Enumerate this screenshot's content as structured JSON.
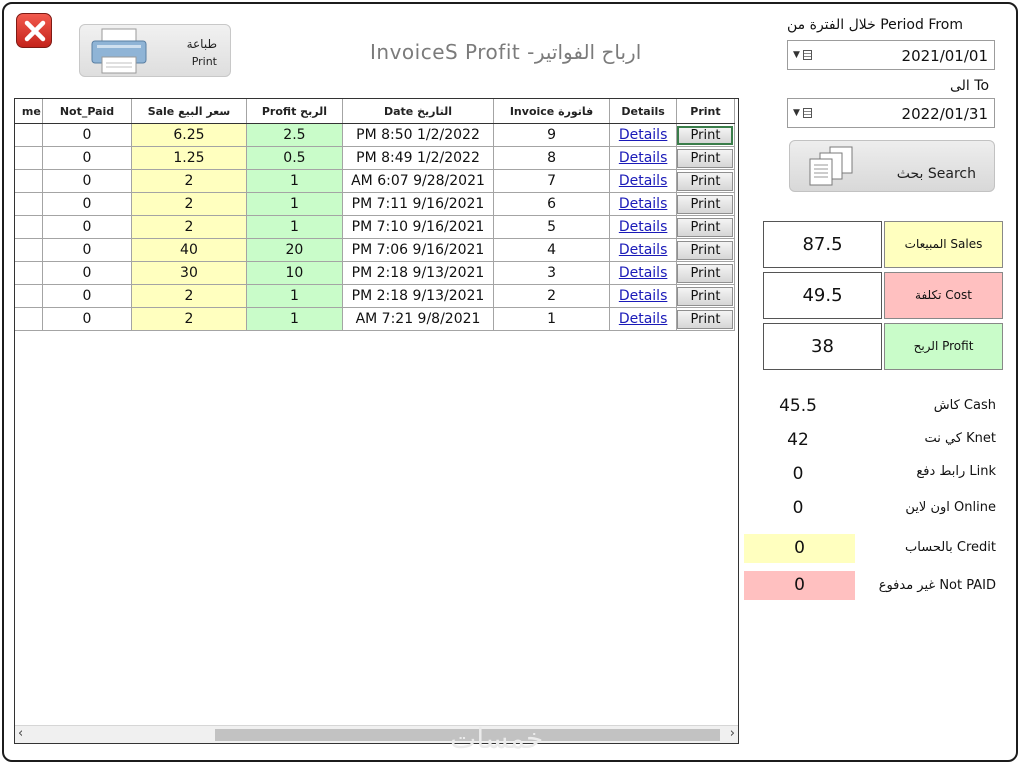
{
  "title": "InvoiceS Profit -ارباح الفواتير",
  "print_button": {
    "label_ar": "طباعة",
    "label_en": "Print"
  },
  "grid": {
    "columns": {
      "partial": "me",
      "not_paid": "Not_Paid",
      "sale": "Sale سعر البيع",
      "profit": "Profit الربح",
      "date": "Date التاريخ",
      "invoice": "Invoice فاتورة",
      "details": "Details",
      "print": "Print"
    },
    "rows": [
      {
        "not_paid": "0",
        "sale": "6.25",
        "profit": "2.5",
        "date": "PM 8:50 1/2/2022",
        "invoice": "9",
        "details": "Details",
        "print": "Print"
      },
      {
        "not_paid": "0",
        "sale": "1.25",
        "profit": "0.5",
        "date": "PM 8:49 1/2/2022",
        "invoice": "8",
        "details": "Details",
        "print": "Print"
      },
      {
        "not_paid": "0",
        "sale": "2",
        "profit": "1",
        "date": "AM 6:07 9/28/2021",
        "invoice": "7",
        "details": "Details",
        "print": "Print"
      },
      {
        "not_paid": "0",
        "sale": "2",
        "profit": "1",
        "date": "PM 7:11 9/16/2021",
        "invoice": "6",
        "details": "Details",
        "print": "Print"
      },
      {
        "not_paid": "0",
        "sale": "2",
        "profit": "1",
        "date": "PM 7:10 9/16/2021",
        "invoice": "5",
        "details": "Details",
        "print": "Print"
      },
      {
        "not_paid": "0",
        "sale": "40",
        "profit": "20",
        "date": "PM 7:06 9/16/2021",
        "invoice": "4",
        "details": "Details",
        "print": "Print"
      },
      {
        "not_paid": "0",
        "sale": "30",
        "profit": "10",
        "date": "PM 2:18 9/13/2021",
        "invoice": "3",
        "details": "Details",
        "print": "Print"
      },
      {
        "not_paid": "0",
        "sale": "2",
        "profit": "1",
        "date": "PM 2:18 9/13/2021",
        "invoice": "2",
        "details": "Details",
        "print": "Print"
      },
      {
        "not_paid": "0",
        "sale": "2",
        "profit": "1",
        "date": "AM 7:21 9/8/2021",
        "invoice": "1",
        "details": "Details",
        "print": "Print"
      }
    ]
  },
  "filter": {
    "from_label": "خلال الفترة من Period From",
    "from_value": "2021/01/01",
    "to_label": "الى To",
    "to_value": "2022/01/31",
    "search_label": "بحث Search"
  },
  "summary": {
    "sales": {
      "label": "المبيعات Sales",
      "value": "87.5"
    },
    "cost": {
      "label": "تكلفة Cost",
      "value": "49.5"
    },
    "profit": {
      "label": "الربح Profit",
      "value": "38"
    }
  },
  "payments": {
    "cash": {
      "label": "كاش Cash",
      "value": "45.5"
    },
    "knet": {
      "label": "كي نت Knet",
      "value": "42"
    },
    "link": {
      "label": "رابط دفع Link",
      "value": "0"
    },
    "online": {
      "label": "اون لاين Online",
      "value": "0"
    },
    "credit": {
      "label": "بالحساب Credit",
      "value": "0"
    },
    "not_paid": {
      "label": "غير مدفوع Not PAID",
      "value": "0"
    }
  },
  "colors": {
    "sale_bg": "#ffffbf",
    "profit_bg": "#c9fcc9",
    "cost_bg": "#ffc0c0",
    "credit_bg": "#ffffbf",
    "notpaid_bg": "#ffc0c0",
    "close_red": "#d63a30"
  },
  "watermark": "خمسات"
}
